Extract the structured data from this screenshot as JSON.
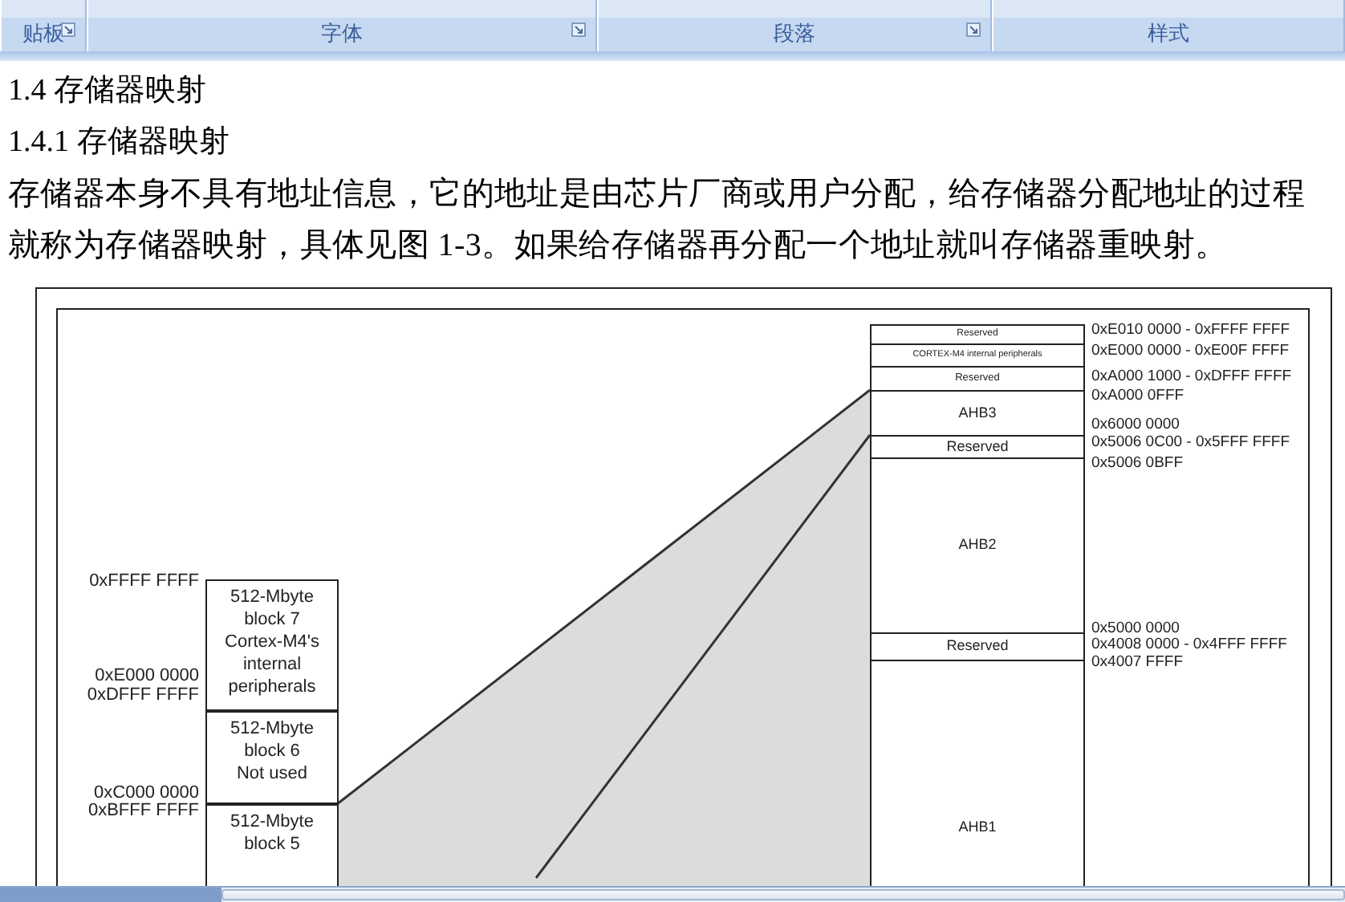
{
  "ribbon": {
    "groups": [
      {
        "label": "贴板",
        "launcher": true
      },
      {
        "label": "字体",
        "launcher": true
      },
      {
        "label": "段落",
        "launcher": true
      },
      {
        "label": "样式",
        "launcher": false
      }
    ]
  },
  "document": {
    "headings": [
      "1.4 存储器映射",
      "1.4.1 存储器映射"
    ],
    "paragraph": "存储器本身不具有地址信息，它的地址是由芯片厂商或用户分配，给存储器分配地址的过程就称为存储器映射，具体见图 1-3。如果给存储器再分配一个地址就叫存储器重映射。",
    "figure": {
      "left_addresses": [
        "0xFFFF FFFF",
        "0xE000 0000",
        "0xDFFF FFFF",
        "0xC000 0000",
        "0xBFFF FFFF"
      ],
      "blocks": [
        [
          "512-Mbyte",
          "block 7",
          "Cortex-M4's",
          "internal",
          "peripherals"
        ],
        [
          "512-Mbyte",
          "block 6",
          "Not used"
        ],
        [
          "512-Mbyte",
          "block 5"
        ]
      ],
      "regions": [
        "Reserved",
        "CORTEX-M4 internal peripherals",
        "Reserved",
        "AHB3",
        "Reserved",
        "AHB2",
        "Reserved",
        "AHB1"
      ],
      "right_addresses": [
        "0xE010 0000 - 0xFFFF FFFF",
        "0xE000 0000 - 0xE00F FFFF",
        "0xA000 1000 - 0xDFFF FFFF",
        "0xA000 0FFF",
        "0x6000 0000",
        "0x5006 0C00 - 0x5FFF FFFF",
        "0x5006 0BFF",
        "0x5000 0000",
        "0x4008 0000 - 0x4FFF FFFF",
        "0x4007 FFFF"
      ]
    }
  }
}
